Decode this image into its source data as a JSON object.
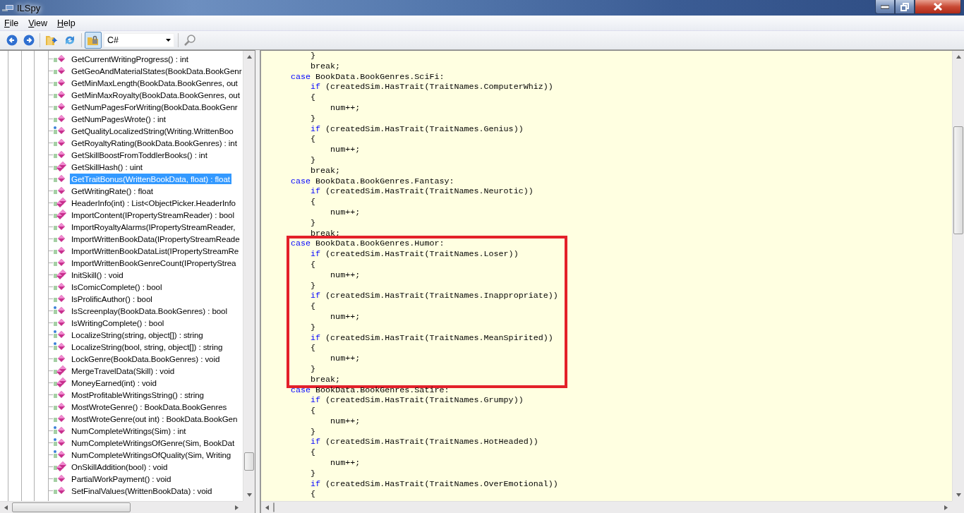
{
  "window": {
    "title": "ILSpy"
  },
  "menu": [
    {
      "label": "File"
    },
    {
      "label": "View"
    },
    {
      "label": "Help"
    }
  ],
  "toolbar": {
    "toggle_button": {
      "pressed": true
    },
    "language": "C#"
  },
  "tree": {
    "items": [
      {
        "label": "GetCurrentWritingProgress() : int",
        "kind": "method",
        "selected": false
      },
      {
        "label": "GetGeoAndMaterialStates(BookData.BookGenr",
        "kind": "method",
        "selected": false
      },
      {
        "label": "GetMinMaxLength(BookData.BookGenres, out",
        "kind": "method",
        "selected": false
      },
      {
        "label": "GetMinMaxRoyalty(BookData.BookGenres, out",
        "kind": "method",
        "selected": false
      },
      {
        "label": "GetNumPagesForWriting(BookData.BookGenr",
        "kind": "method",
        "selected": false
      },
      {
        "label": "GetNumPagesWrote() : int",
        "kind": "method",
        "selected": false
      },
      {
        "label": "GetQualityLocalizedString(Writing.WrittenBoo",
        "kind": "static",
        "selected": false
      },
      {
        "label": "GetRoyaltyRating(BookData.BookGenres) : int",
        "kind": "method",
        "selected": false
      },
      {
        "label": "GetSkillBoostFromToddlerBooks() : int",
        "kind": "method",
        "selected": false
      },
      {
        "label": "GetSkillHash() : uint",
        "kind": "override",
        "selected": false
      },
      {
        "label": "GetTraitBonus(WrittenBookData, float) : float",
        "kind": "method",
        "selected": true
      },
      {
        "label": "GetWritingRate() : float",
        "kind": "method",
        "selected": false
      },
      {
        "label": "HeaderInfo(int) : List<ObjectPicker.HeaderInfo",
        "kind": "override",
        "selected": false
      },
      {
        "label": "ImportContent(IPropertyStreamReader) : bool",
        "kind": "override",
        "selected": false
      },
      {
        "label": "ImportRoyaltyAlarms(IPropertyStreamReader,",
        "kind": "method",
        "selected": false
      },
      {
        "label": "ImportWrittenBookData(IPropertyStreamReade",
        "kind": "method",
        "selected": false
      },
      {
        "label": "ImportWrittenBookDataList(IPropertyStreamRe",
        "kind": "method",
        "selected": false
      },
      {
        "label": "ImportWrittenBookGenreCount(IPropertyStrea",
        "kind": "method",
        "selected": false
      },
      {
        "label": "InitSkill() : void",
        "kind": "override",
        "selected": false
      },
      {
        "label": "IsComicComplete() : bool",
        "kind": "method",
        "selected": false
      },
      {
        "label": "IsProlificAuthor() : bool",
        "kind": "method",
        "selected": false
      },
      {
        "label": "IsScreenplay(BookData.BookGenres) : bool",
        "kind": "static",
        "selected": false
      },
      {
        "label": "IsWritingComplete() : bool",
        "kind": "method",
        "selected": false
      },
      {
        "label": "LocalizeString(string, object[]) : string",
        "kind": "static",
        "selected": false
      },
      {
        "label": "LocalizeString(bool, string, object[]) : string",
        "kind": "static",
        "selected": false
      },
      {
        "label": "LockGenre(BookData.BookGenres) : void",
        "kind": "method",
        "selected": false
      },
      {
        "label": "MergeTravelData(Skill) : void",
        "kind": "override",
        "selected": false
      },
      {
        "label": "MoneyEarned(int) : void",
        "kind": "override",
        "selected": false
      },
      {
        "label": "MostProfitableWritingsString() : string",
        "kind": "method",
        "selected": false
      },
      {
        "label": "MostWroteGenre() : BookData.BookGenres",
        "kind": "method",
        "selected": false
      },
      {
        "label": "MostWroteGenre(out int) : BookData.BookGen",
        "kind": "method",
        "selected": false
      },
      {
        "label": "NumCompleteWritings(Sim) : int",
        "kind": "static",
        "selected": false
      },
      {
        "label": "NumCompleteWritingsOfGenre(Sim, BookDat",
        "kind": "static",
        "selected": false
      },
      {
        "label": "NumCompleteWritingsOfQuality(Sim, Writing",
        "kind": "static",
        "selected": false
      },
      {
        "label": "OnSkillAddition(bool) : void",
        "kind": "override",
        "selected": false
      },
      {
        "label": "PartialWorkPayment() : void",
        "kind": "method",
        "selected": false
      },
      {
        "label": "SetFinalValues(WrittenBookData) : void",
        "kind": "method",
        "selected": false
      }
    ]
  },
  "code": {
    "blocks": [
      {
        "highlighted": false,
        "lines": [
          {
            "text": "    }"
          },
          {
            "text": "    break;"
          },
          {
            "keyword": "case",
            "text": " BookData.BookGenres.SciFi:"
          },
          {
            "keyword": "    if",
            "text": " (createdSim.HasTrait(TraitNames.ComputerWhiz))"
          },
          {
            "text": "    {"
          },
          {
            "text": "        num++;"
          },
          {
            "text": "    }"
          },
          {
            "keyword": "    if",
            "text": " (createdSim.HasTrait(TraitNames.Genius))"
          },
          {
            "text": "    {"
          },
          {
            "text": "        num++;"
          },
          {
            "text": "    }"
          },
          {
            "text": "    break;"
          },
          {
            "keyword": "case",
            "text": " BookData.BookGenres.Fantasy:"
          },
          {
            "keyword": "    if",
            "text": " (createdSim.HasTrait(TraitNames.Neurotic))"
          },
          {
            "text": "    {"
          },
          {
            "text": "        num++;"
          },
          {
            "text": "    }"
          },
          {
            "text": "    break;"
          }
        ]
      },
      {
        "highlighted": true,
        "lines": [
          {
            "keyword": "case",
            "text": " BookData.BookGenres.Humor:"
          },
          {
            "keyword": "    if",
            "text": " (createdSim.HasTrait(TraitNames.Loser))"
          },
          {
            "text": "    {"
          },
          {
            "text": "        num++;"
          },
          {
            "text": "    }"
          },
          {
            "keyword": "    if",
            "text": " (createdSim.HasTrait(TraitNames.Inappropriate))"
          },
          {
            "text": "    {"
          },
          {
            "text": "        num++;"
          },
          {
            "text": "    }"
          },
          {
            "keyword": "    if",
            "text": " (createdSim.HasTrait(TraitNames.MeanSpirited))"
          },
          {
            "text": "    {"
          },
          {
            "text": "        num++;"
          },
          {
            "text": "    }"
          },
          {
            "text": "    break;"
          }
        ]
      },
      {
        "highlighted": false,
        "lines": [
          {
            "keyword": "case",
            "text": " BookData.BookGenres.Satire:"
          },
          {
            "keyword": "    if",
            "text": " (createdSim.HasTrait(TraitNames.Grumpy))"
          },
          {
            "text": "    {"
          },
          {
            "text": "        num++;"
          },
          {
            "text": "    }"
          },
          {
            "keyword": "    if",
            "text": " (createdSim.HasTrait(TraitNames.HotHeaded))"
          },
          {
            "text": "    {"
          },
          {
            "text": "        num++;"
          },
          {
            "text": "    }"
          },
          {
            "keyword": "    if",
            "text": " (createdSim.HasTrait(TraitNames.OverEmotional))"
          },
          {
            "text": "    {"
          }
        ]
      }
    ]
  }
}
